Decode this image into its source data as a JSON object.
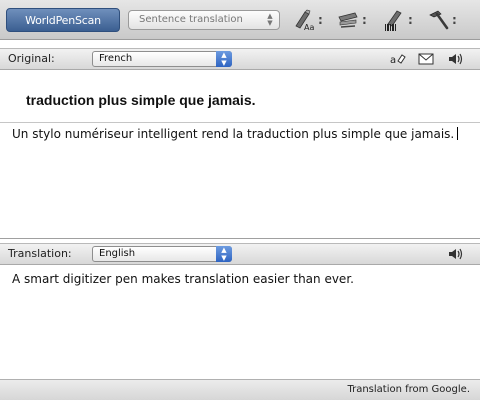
{
  "toolbar": {
    "brand": "WorldPenScan",
    "mode": "Sentence translation",
    "tools": [
      {
        "icon": "pen-font-icon",
        "menu": ":"
      },
      {
        "icon": "scanner-pen-icon",
        "menu": ":"
      },
      {
        "icon": "barcode-pen-icon",
        "menu": ":"
      },
      {
        "icon": "hammer-icon",
        "menu": ":"
      }
    ]
  },
  "original": {
    "label": "Original:",
    "language": "French",
    "icons": [
      "eraser-icon",
      "mail-icon",
      "speaker-icon"
    ],
    "scanned_line": "traduction plus simple que jamais.",
    "text": "Un stylo numériseur intelligent rend la traduction plus simple que jamais."
  },
  "translation": {
    "label": "Translation:",
    "language": "English",
    "icons": [
      "speaker-icon"
    ],
    "text": "A smart digitizer pen makes translation easier than ever."
  },
  "status": {
    "text": "Translation from Google."
  },
  "colors": {
    "brand_bg": "#3b5f91",
    "select_arrow_blue": "#2e64c2"
  }
}
